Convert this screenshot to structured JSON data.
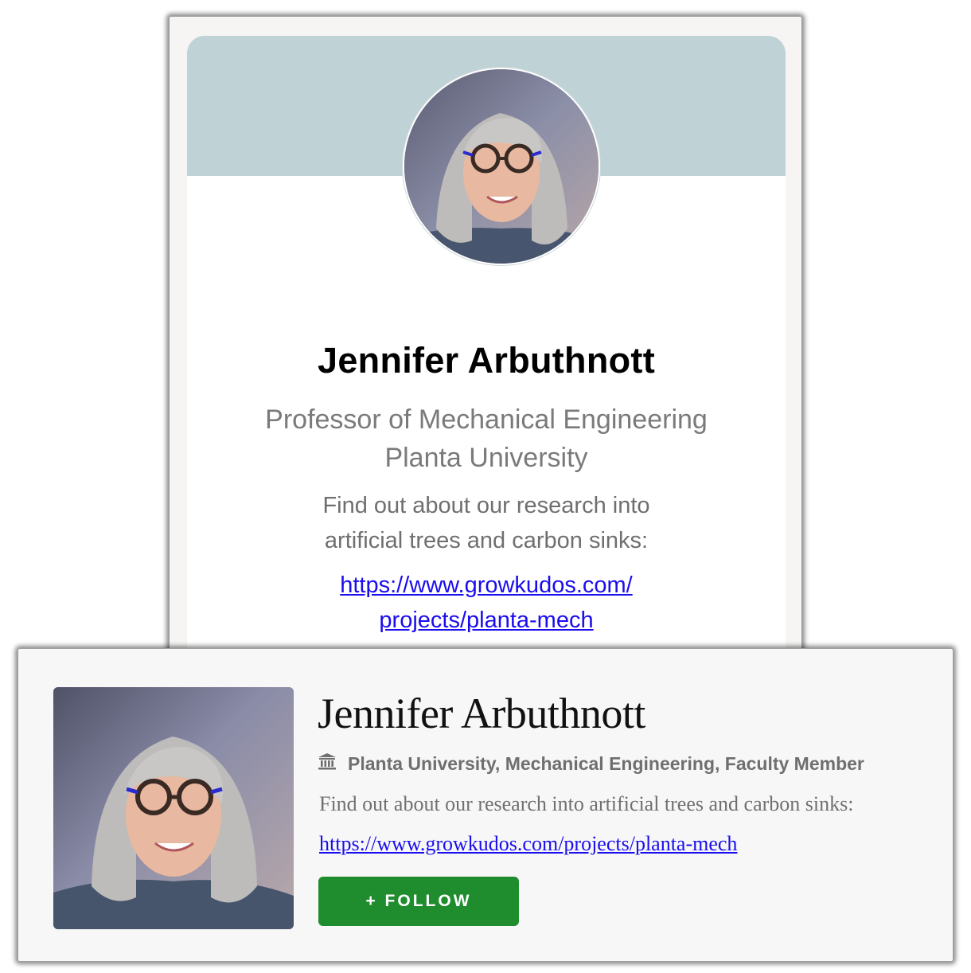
{
  "profile_card": {
    "name": "Jennifer Arbuthnott",
    "title_line1": "Professor of Mechanical Engineering",
    "title_line2": "Planta University",
    "description_line1": "Find out about our research into",
    "description_line2": "artificial trees and carbon sinks:",
    "link_line1": "https://www.growkudos.com/",
    "link_line2": "projects/planta-mech",
    "link_href": "https://www.growkudos.com/projects/planta-mech",
    "banner_color": "#bfd3d6"
  },
  "kudos_card": {
    "name": "Jennifer Arbuthnott",
    "affiliation": "Planta University, Mechanical Engineering, Faculty Member",
    "affiliation_icon": "institution-icon",
    "description": "Find out about our research into artificial trees and carbon sinks:",
    "link_text": "https://www.growkudos.com/projects/planta-mech",
    "follow_label": "+ FOLLOW",
    "follow_color": "#1f8c2e",
    "link_color": "#1a0dee"
  }
}
